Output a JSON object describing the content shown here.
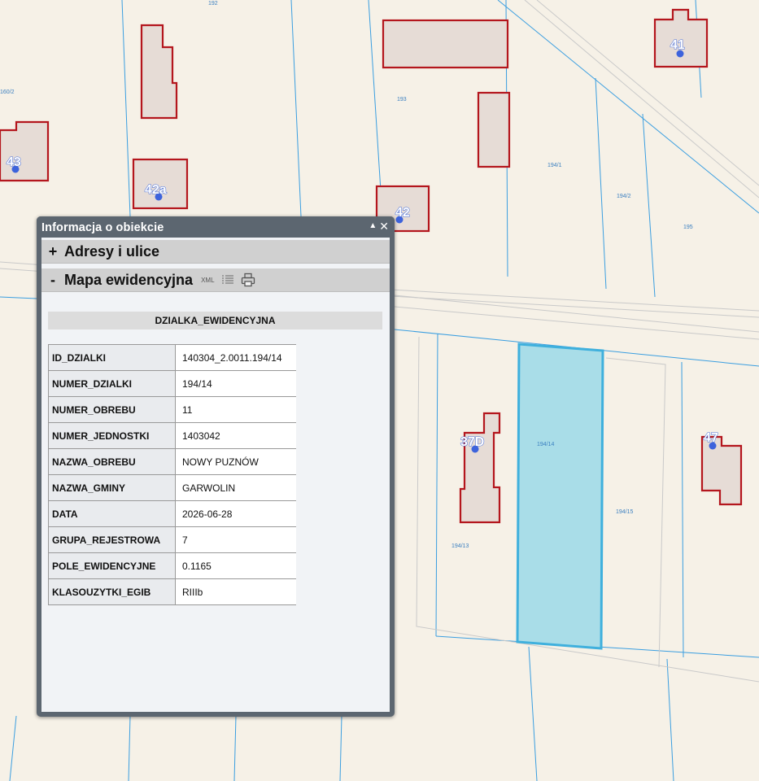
{
  "map": {
    "house_numbers": [
      {
        "id": "41",
        "text": "41"
      },
      {
        "id": "43",
        "text": "43"
      },
      {
        "id": "42a",
        "text": "42a"
      },
      {
        "id": "42",
        "text": "42"
      },
      {
        "id": "37d",
        "text": "37D"
      },
      {
        "id": "47",
        "text": "47"
      }
    ],
    "plot_numbers": [
      "194/1",
      "194/2",
      "195",
      "194/14",
      "194/15",
      "194/13",
      "193",
      "192",
      "160/2"
    ],
    "selected_parcel_color": "#a9dde8",
    "building_outline_color": "#b4161d",
    "parcel_line_color": "#3a9ee0"
  },
  "panel": {
    "title": "Informacja o obiekcie",
    "minimize_label": "▲",
    "close_label": "✕",
    "sections": [
      {
        "sign": "+",
        "label": "Adresy i ulice"
      },
      {
        "sign": "-",
        "label": "Mapa ewidencyjna",
        "xml_label": "XML"
      }
    ],
    "table_title": "DZIALKA_EWIDENCYJNA",
    "rows": [
      {
        "key": "ID_DZIALKI",
        "value": "140304_2.0011.194/14"
      },
      {
        "key": "NUMER_DZIALKI",
        "value": "194/14"
      },
      {
        "key": "NUMER_OBREBU",
        "value": "11"
      },
      {
        "key": "NUMER_JEDNOSTKI",
        "value": "1403042"
      },
      {
        "key": "NAZWA_OBREBU",
        "value": "NOWY PUZNÓW"
      },
      {
        "key": "NAZWA_GMINY",
        "value": "GARWOLIN"
      },
      {
        "key": "DATA",
        "value": "2026-06-28"
      },
      {
        "key": "GRUPA_REJESTROWA",
        "value": "7"
      },
      {
        "key": "POLE_EWIDENCYJNE",
        "value": "0.1165"
      },
      {
        "key": "KLASOUZYTKI_EGIB",
        "value": "RIIIb"
      }
    ]
  }
}
